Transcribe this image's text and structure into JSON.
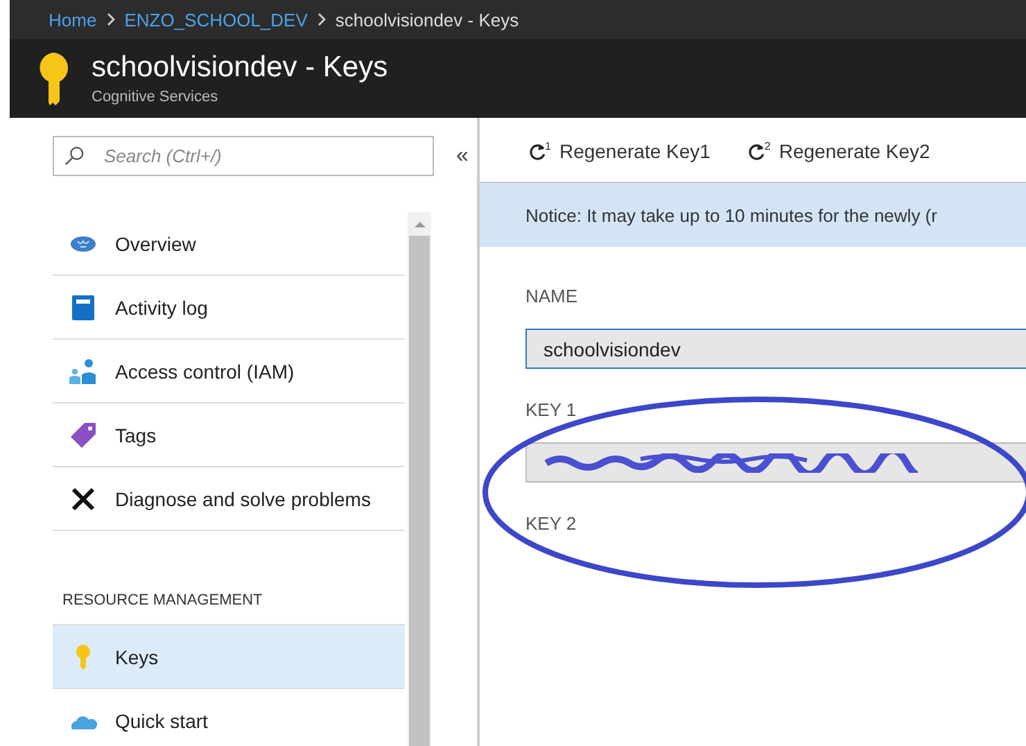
{
  "breadcrumb": [
    {
      "label": "Home",
      "link": true
    },
    {
      "label": "ENZO_SCHOOL_DEV",
      "link": true
    },
    {
      "label": "schoolvisiondev - Keys",
      "link": false
    }
  ],
  "header": {
    "title": "schoolvisiondev - Keys",
    "subtitle": "Cognitive Services"
  },
  "sidebar": {
    "search": {
      "placeholder": "Search (Ctrl+/)"
    },
    "collapse": "«",
    "groups": [
      {
        "items": [
          {
            "label": "Overview",
            "selected": false
          },
          {
            "label": "Activity log",
            "selected": false
          },
          {
            "label": "Access control (IAM)",
            "selected": false
          },
          {
            "label": "Tags",
            "selected": false
          },
          {
            "label": "Diagnose and solve problems",
            "selected": false
          }
        ]
      },
      {
        "heading": "RESOURCE MANAGEMENT",
        "items": [
          {
            "label": "Keys",
            "selected": true
          },
          {
            "label": "Quick start",
            "selected": false
          }
        ]
      }
    ]
  },
  "toolbar": [
    {
      "label": "Regenerate Key1",
      "number": "1"
    },
    {
      "label": "Regenerate Key2",
      "number": "2"
    }
  ],
  "notice": "Notice: It may take up to 10 minutes for the newly (r",
  "fields": [
    {
      "label": "NAME",
      "value": "schoolvisiondev",
      "focused": true
    },
    {
      "label": "KEY 1",
      "redacted": true,
      "focused": false
    },
    {
      "label": "KEY 2"
    }
  ],
  "annotation": {
    "kind": "ellipse"
  }
}
